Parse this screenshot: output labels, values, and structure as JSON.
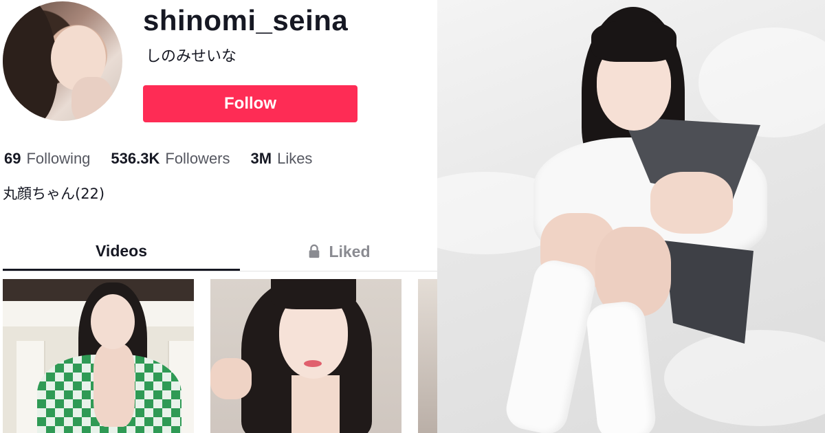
{
  "profile": {
    "username": "shinomi_seina",
    "nickname": "しのみせいな",
    "follow_label": "Follow",
    "bio": "丸顔ちゃん(22)"
  },
  "stats": [
    {
      "value": "69",
      "label": "Following"
    },
    {
      "value": "536.3K",
      "label": "Followers"
    },
    {
      "value": "3M",
      "label": "Likes"
    }
  ],
  "tabs": {
    "videos": "Videos",
    "liked": "Liked"
  },
  "colors": {
    "follow_button": "#fe2c55",
    "text_primary": "#161823",
    "text_secondary": "#555760",
    "tab_inactive": "#8a8b91"
  },
  "icons": {
    "liked_tab": "lock-icon"
  }
}
